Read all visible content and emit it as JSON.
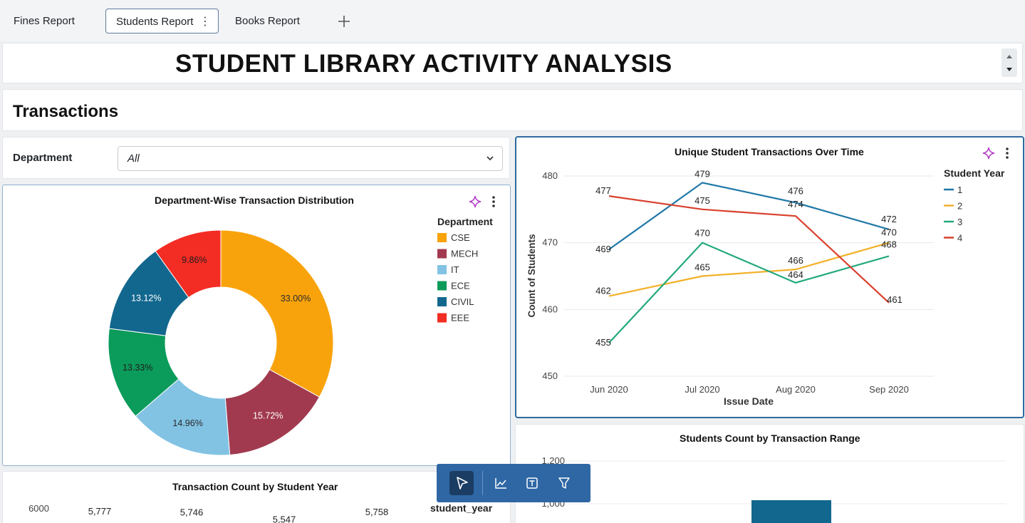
{
  "tabs": [
    {
      "label": "Fines Report"
    },
    {
      "label": "Students Report",
      "menu": "⋮"
    },
    {
      "label": "Books Report"
    }
  ],
  "header": {
    "title": "STUDENT LIBRARY ACTIVITY ANALYSIS"
  },
  "section": {
    "title": "Transactions"
  },
  "filter": {
    "label": "Department",
    "value": "All"
  },
  "colors": {
    "cse": "#f9a30c",
    "mech": "#a23a4f",
    "it": "#82c3e4",
    "ece": "#0b9b5a",
    "civil": "#12678e",
    "eee": "#f32c24",
    "year1": "#1f77a8",
    "year2": "#f2b12a",
    "year3": "#23a97c",
    "year4": "#d9412e",
    "accent": "#2f6aa0",
    "toolbar": "#2f67a5"
  },
  "toolbar": {
    "icons": [
      "select-pointer-icon",
      "line-chart-icon",
      "text-box-icon",
      "filter-icon"
    ]
  },
  "chart_data": [
    {
      "type": "pie",
      "title": "Department-Wise Transaction Distribution",
      "legend_title": "Department",
      "legend_position": "right",
      "categories": [
        "CSE",
        "MECH",
        "IT",
        "ECE",
        "CIVIL",
        "EEE"
      ],
      "values": [
        33.0,
        15.72,
        14.96,
        13.33,
        13.12,
        9.86
      ],
      "labels": [
        "33.00%",
        "15.72%",
        "14.96%",
        "13.33%",
        "13.12%",
        "9.86%"
      ],
      "colors": [
        "#f9a30c",
        "#a23a4f",
        "#82c3e4",
        "#0b9b5a",
        "#12678e",
        "#f32c24"
      ]
    },
    {
      "type": "line",
      "title": "Unique Student Transactions Over Time",
      "xlabel": "Issue Date",
      "ylabel": "Count of Students",
      "ylim": [
        450,
        480
      ],
      "yticks": [
        "450",
        "460",
        "470",
        "480"
      ],
      "categories": [
        "Jun 2020",
        "Jul 2020",
        "Aug 2020",
        "Sep 2020"
      ],
      "legend_title": "Student Year",
      "legend_position": "right",
      "grid": true,
      "series": [
        {
          "name": "1",
          "values": [
            469,
            479,
            476,
            472
          ],
          "color": "#1f77a8"
        },
        {
          "name": "2",
          "values": [
            462,
            465,
            466,
            470
          ],
          "color": "#f2b12a"
        },
        {
          "name": "3",
          "values": [
            455,
            470,
            464,
            468
          ],
          "color": "#23a97c"
        },
        {
          "name": "4",
          "values": [
            477,
            475,
            474,
            461
          ],
          "color": "#d9412e"
        }
      ]
    },
    {
      "type": "bar",
      "title": "Transaction Count by Student Year",
      "legend_title": "student_year",
      "yticks": [
        "6000"
      ],
      "value_labels": [
        "5,777",
        "5,746",
        "5,547",
        "5,758"
      ],
      "values": [
        5777,
        5746,
        5547,
        5758
      ]
    },
    {
      "type": "bar",
      "title": "Students Count by Transaction Range",
      "yticks": [
        "1,200",
        "1,000"
      ]
    }
  ]
}
